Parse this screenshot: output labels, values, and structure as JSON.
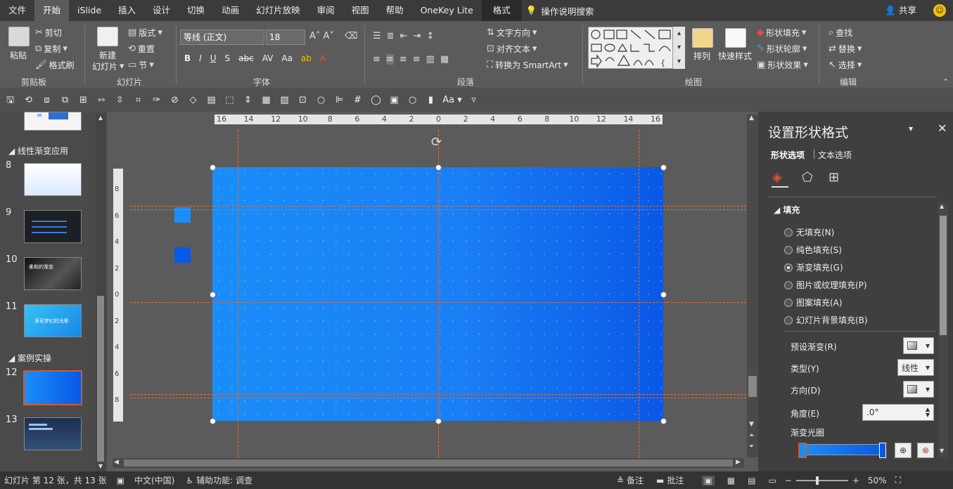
{
  "menu": {
    "file": "文件",
    "tabs": [
      "开始",
      "iSlide",
      "插入",
      "设计",
      "切换",
      "动画",
      "幻灯片放映",
      "审阅",
      "视图",
      "帮助",
      "OneKey Lite",
      "格式"
    ],
    "tell_me": "操作说明搜索",
    "share": "共享"
  },
  "ribbon": {
    "clipboard": {
      "paste": "粘贴",
      "cut": "剪切",
      "copy": "复制",
      "format_painter": "格式刷",
      "label": "剪贴板"
    },
    "slides": {
      "new_slide": "新建",
      "new_slide_2": "幻灯片",
      "layout": "版式",
      "reset": "重置",
      "section": "节",
      "label": "幻灯片"
    },
    "font": {
      "font_name": "等线 (正文)",
      "font_size": "18",
      "label": "字体",
      "bold": "B",
      "italic": "I",
      "underline": "U",
      "shadow": "S",
      "strike": "abc",
      "spacing": "AV",
      "case": "Aa"
    },
    "paragraph": {
      "text_direction": "文字方向",
      "align_text": "对齐文本",
      "smartart": "转换为 SmartArt",
      "label": "段落"
    },
    "drawing": {
      "arrange": "排列",
      "quick_styles": "快速样式",
      "shape_fill": "形状填充",
      "shape_outline": "形状轮廓",
      "shape_effects": "形状效果",
      "label": "绘图"
    },
    "editing": {
      "find": "查找",
      "replace": "替换",
      "select": "选择",
      "label": "编辑"
    }
  },
  "sidebar": {
    "sections": [
      {
        "title": "线性渐变应用"
      },
      {
        "title": "案例实操"
      }
    ],
    "slides": [
      "8",
      "9",
      "10",
      "11",
      "12",
      "13"
    ],
    "thumb_text": {
      "s10": "柔和的渐变",
      "s11": "多彩梦幻的光影"
    }
  },
  "ruler": {
    "h_ticks": [
      "16",
      "14",
      "12",
      "10",
      "8",
      "6",
      "4",
      "2",
      "0",
      "2",
      "4",
      "6",
      "8",
      "10",
      "12",
      "14",
      "16"
    ],
    "v_ticks": [
      "8",
      "6",
      "4",
      "2",
      "0",
      "2",
      "4",
      "6",
      "8"
    ]
  },
  "pane": {
    "title": "设置形状格式",
    "tab_shape": "形状选项",
    "tab_text": "文本选项",
    "section_fill": "填充",
    "options": [
      "无填充(N)",
      "纯色填充(S)",
      "渐变填充(G)",
      "图片或纹理填充(P)",
      "图案填充(A)",
      "幻灯片背景填充(B)"
    ],
    "selected_option": "渐变填充(G)",
    "preset_label": "预设渐变(R)",
    "type_label": "类型(Y)",
    "type_value": "线性",
    "direction_label": "方向(D)",
    "angle_label": "角度(E)",
    "angle_value": ".0°",
    "stops_label": "渐变光圈"
  },
  "status": {
    "slide_info": "幻灯片 第 12 张，共 13 张",
    "language": "中文(中国)",
    "accessibility": "辅助功能: 调查",
    "notes": "备注",
    "comments": "批注",
    "zoom": "50%"
  },
  "colors": {
    "accent": "#d45a2a",
    "gradient_start": "#1a8df8",
    "gradient_end": "#0a58e6"
  }
}
